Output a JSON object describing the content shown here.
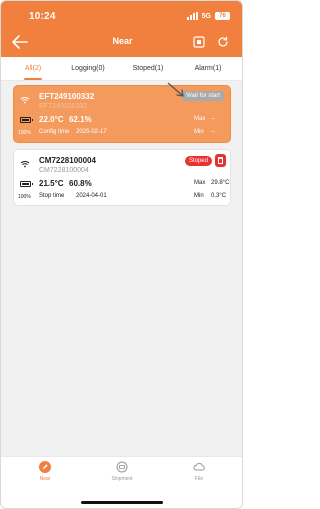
{
  "status_bar": {
    "time": "10:24",
    "network": "5G",
    "battery": "76"
  },
  "header": {
    "title": "Near"
  },
  "tabs": [
    {
      "label": "All(2)",
      "active": true
    },
    {
      "label": "Logging(0)",
      "active": false
    },
    {
      "label": "Stoped(1)",
      "active": false
    },
    {
      "label": "Alarm(1)",
      "active": false
    }
  ],
  "devices": [
    {
      "id": "EFT249100332",
      "sub_id": "EFT249100332",
      "temperature": "22.0°C",
      "humidity": "62.1%",
      "battery": "100%",
      "time_label": "Config time",
      "time_value": "2025-02-17",
      "status": "Wait for start",
      "max_label": "Max",
      "max_value": "--",
      "min_label": "Min",
      "min_value": "--"
    },
    {
      "id": "CM7228100004",
      "sub_id": "CM7228100004",
      "temperature": "21.5°C",
      "humidity": "60.8%",
      "battery": "100%",
      "time_label": "Stop time",
      "time_value": "2024-04-01",
      "status": "Stoped",
      "max_label": "Max",
      "max_value": "29.8°C",
      "min_label": "Min",
      "min_value": "0.3°C"
    }
  ],
  "bottom_nav": [
    {
      "label": "Near",
      "icon": "pen-icon",
      "active": true
    },
    {
      "label": "Shipment",
      "icon": "shipment-icon",
      "active": false
    },
    {
      "label": "File",
      "icon": "cloud-icon",
      "active": false
    }
  ],
  "colors": {
    "accent": "#f17f3d",
    "card_active": "#f39a5c",
    "stop_badge": "#e8322d",
    "wait_badge": "#a9a9a9",
    "content_bg": "#f1f1f1"
  }
}
